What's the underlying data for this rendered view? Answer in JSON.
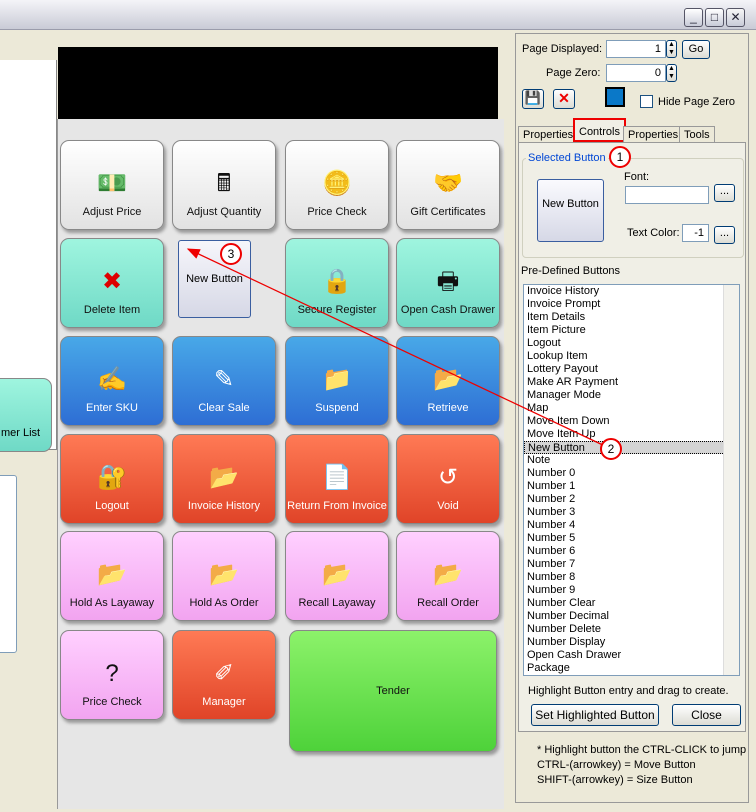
{
  "window": {
    "minimize": "_",
    "maximize": "□",
    "close": "✕"
  },
  "grid_buttons": [
    {
      "label": "Adjust Price",
      "icon": "money-icon",
      "glyph": "💵",
      "color": "white"
    },
    {
      "label": "Adjust Quantity",
      "icon": "calculator-icon",
      "glyph": "🖩",
      "color": "white"
    },
    {
      "label": "Price Check",
      "icon": "coin-icon",
      "glyph": "🪙",
      "color": "white"
    },
    {
      "label": "Gift Certificates",
      "icon": "handshake-icon",
      "glyph": "🤝",
      "color": "white"
    },
    {
      "label": "Delete Item",
      "icon": "x-icon",
      "glyph": "✖",
      "color": "teal"
    },
    {
      "label": "Secure Register",
      "icon": "lock-icon",
      "glyph": "🔒",
      "color": "teal"
    },
    {
      "label": "Open Cash Drawer",
      "icon": "cash-register-icon",
      "glyph": "🖶",
      "color": "teal"
    },
    {
      "label": "Enter SKU",
      "icon": "sku-icon",
      "glyph": "✍",
      "color": "blue"
    },
    {
      "label": "Clear Sale",
      "icon": "pencil-icon",
      "glyph": "✎",
      "color": "blue"
    },
    {
      "label": "Suspend",
      "icon": "folder-icon",
      "glyph": "📁",
      "color": "blue"
    },
    {
      "label": "Retrieve",
      "icon": "retrieve-icon",
      "glyph": "📂",
      "color": "blue"
    },
    {
      "label": "Logout",
      "icon": "padlock-key-icon",
      "glyph": "🔐",
      "color": "red"
    },
    {
      "label": "Invoice History",
      "icon": "folder-icon",
      "glyph": "📂",
      "color": "red"
    },
    {
      "label": "Return From Invoice",
      "icon": "return-icon",
      "glyph": "📄",
      "color": "red"
    },
    {
      "label": "Void",
      "icon": "void-icon",
      "glyph": "↺",
      "color": "red"
    },
    {
      "label": "Hold As Layaway",
      "icon": "folder-icon",
      "glyph": "📂",
      "color": "pink"
    },
    {
      "label": "Hold As Order",
      "icon": "folder-icon",
      "glyph": "📂",
      "color": "pink"
    },
    {
      "label": "Recall Layaway",
      "icon": "folder-icon",
      "glyph": "📂",
      "color": "pink"
    },
    {
      "label": "Recall Order",
      "icon": "folder-icon",
      "glyph": "📂",
      "color": "pink"
    },
    {
      "label": "Price Check",
      "icon": "question-icon",
      "glyph": "?",
      "color": "pink"
    },
    {
      "label": "Manager",
      "icon": "manager-icon",
      "glyph": "✐",
      "color": "red"
    },
    {
      "label": "Tender",
      "icon": "",
      "glyph": "",
      "color": "green"
    }
  ],
  "new_button": "New Button",
  "customer_list": "mer List",
  "panel": {
    "page_displayed_label": "Page Displayed:",
    "page_displayed": "1",
    "go": "Go",
    "page_zero_label": "Page Zero:",
    "page_zero": "0",
    "hide_page_zero": "Hide Page Zero",
    "swatch_color": "#0a78c8",
    "tabs": [
      "Properties",
      "Controls",
      "Properties",
      "Tools"
    ],
    "selected_button_legend": "Selected Button",
    "selected_button_preview": "New Button",
    "font_label": "Font:",
    "font_value": "",
    "text_color_label": "Text Color:",
    "text_color": "-1",
    "ellipsis": "...",
    "predefined_label": "Pre-Defined Buttons",
    "list": [
      "Invoice History",
      "Invoice Prompt",
      "Item Details",
      "Item Picture",
      "Logout",
      "Lookup Item",
      "Lottery Payout",
      "Make AR Payment",
      "Manager Mode",
      "Map",
      "Move Item Down",
      "Move Item Up",
      "New Button",
      "Note",
      "Number 0",
      "Number 1",
      "Number 2",
      "Number 3",
      "Number 4",
      "Number 5",
      "Number 6",
      "Number 7",
      "Number 8",
      "Number 9",
      "Number Clear",
      "Number Decimal",
      "Number Delete",
      "Number Display",
      "Open Cash Drawer",
      "Package"
    ],
    "selected_item": "New Button",
    "hint": "Highlight Button entry and drag to create.",
    "set_highlighted": "Set Highlighted Button",
    "close": "Close",
    "notes": [
      "* Highlight button the CTRL-CLICK to jump",
      "CTRL-(arrowkey) = Move Button",
      "SHIFT-(arrowkey) = Size Button"
    ]
  },
  "callouts": [
    "1",
    "2",
    "3"
  ]
}
